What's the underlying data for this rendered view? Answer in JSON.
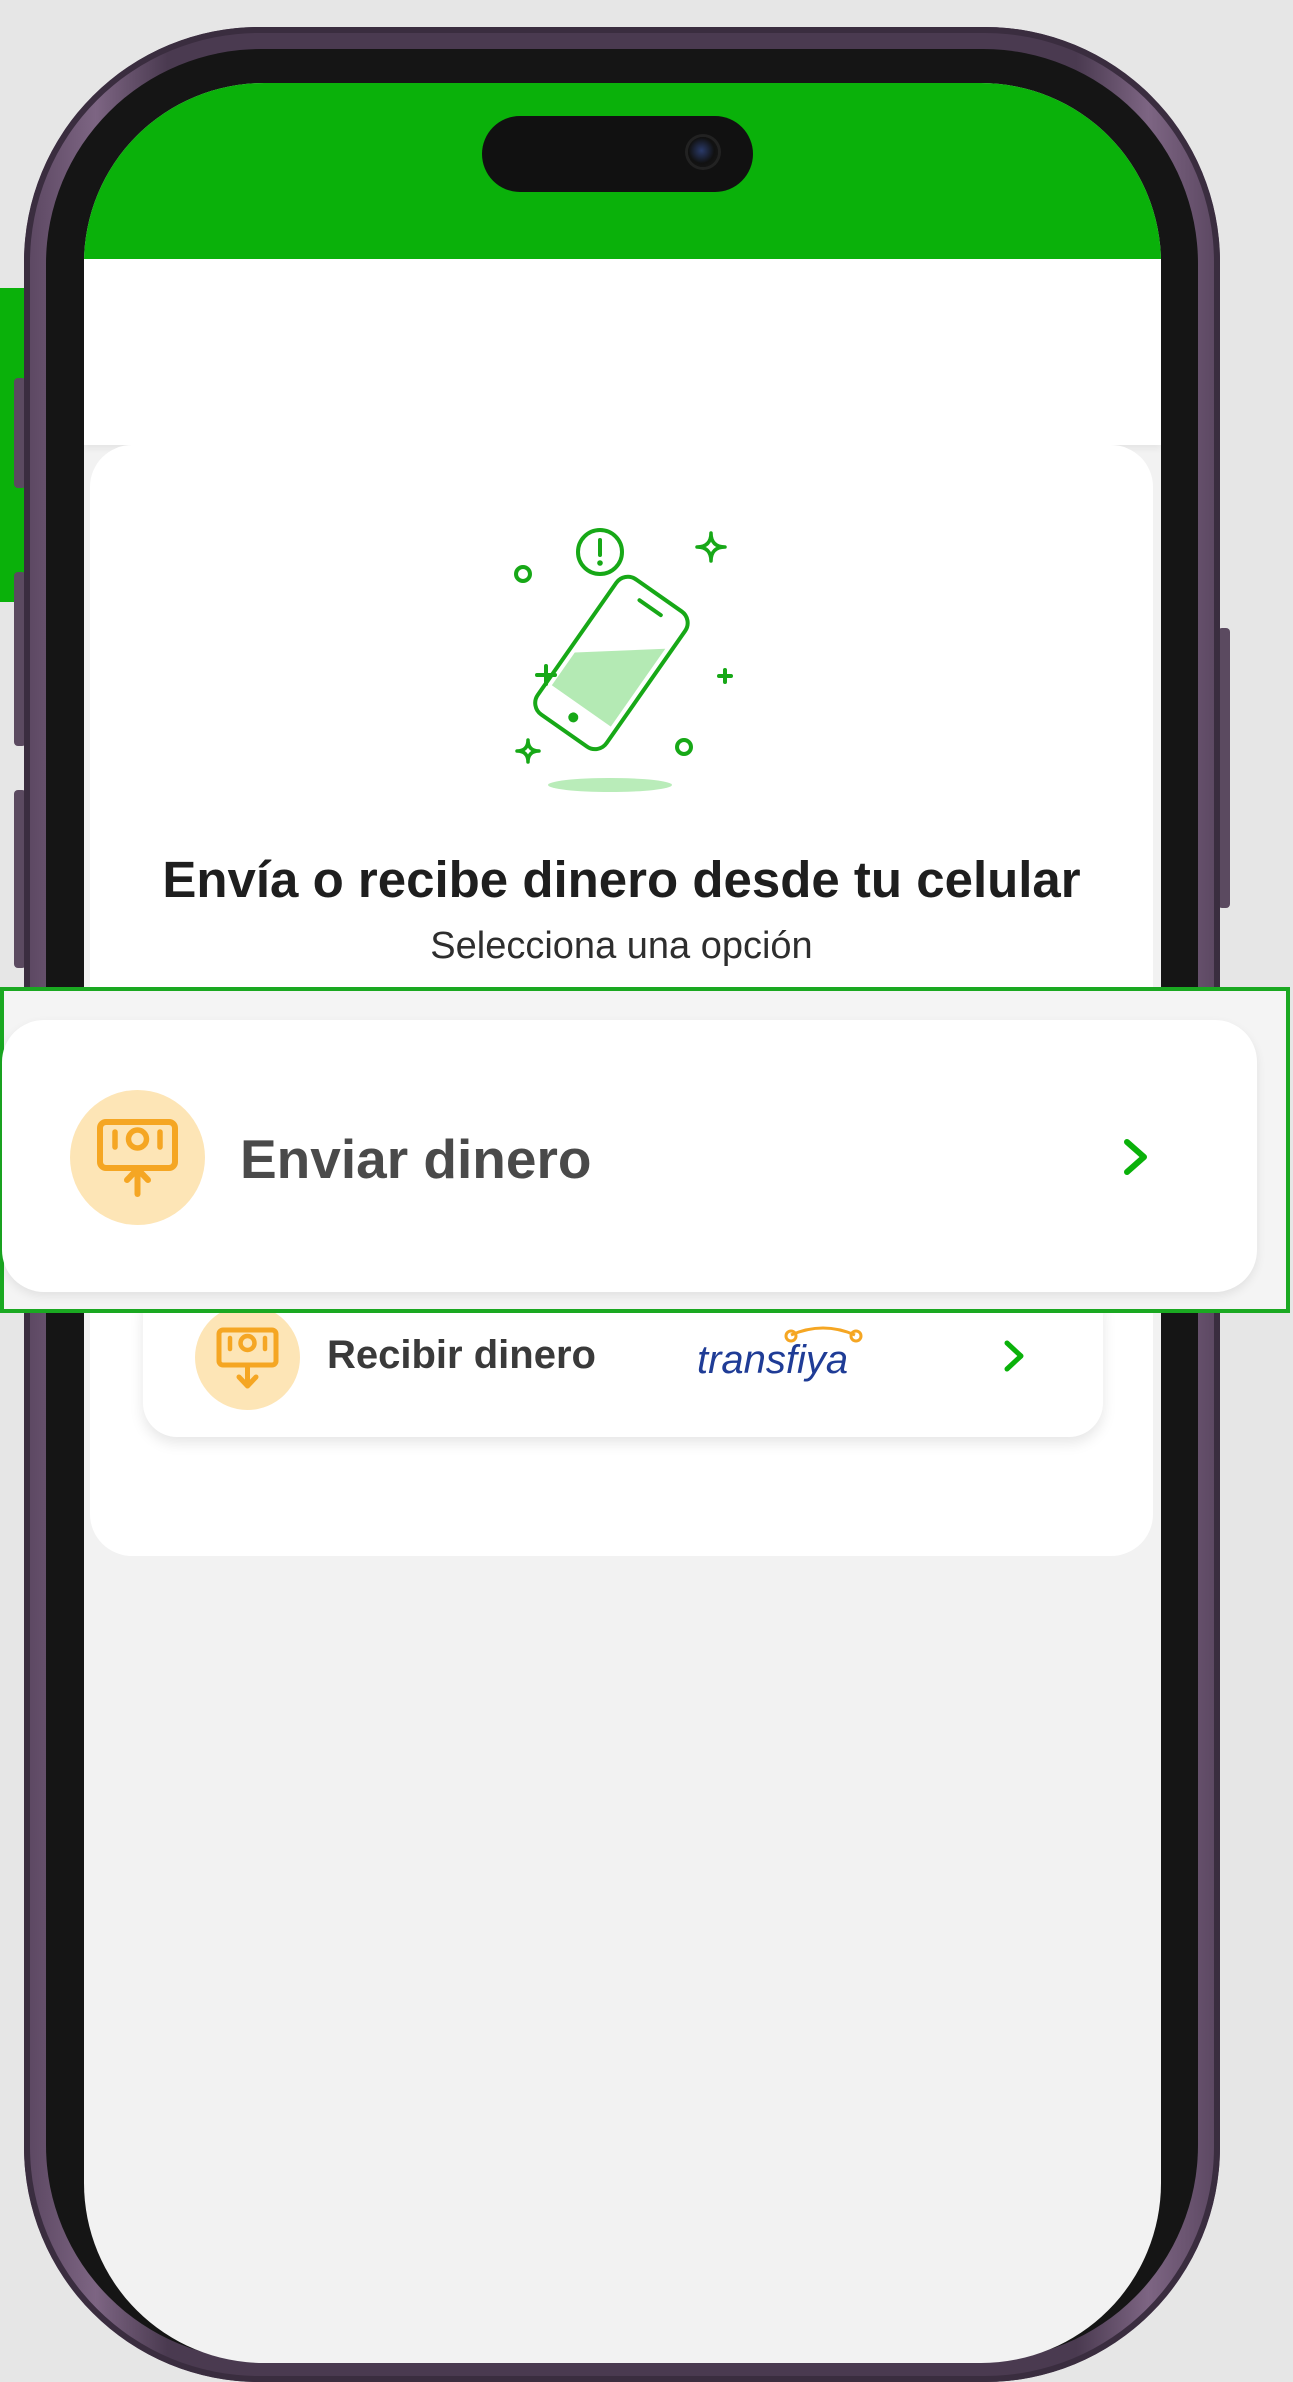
{
  "card": {
    "title": "Envía o recibe dinero desde tu celular",
    "subtitle": "Selecciona una opción"
  },
  "options": {
    "send": {
      "label": "Enviar dinero",
      "icon": "money-send-icon"
    },
    "receive": {
      "label": "Recibir dinero",
      "icon": "money-receive-icon",
      "partner": "transfiya"
    }
  },
  "colors": {
    "brand_green": "#0ab10a",
    "icon_orange": "#f5a623",
    "icon_bg": "#fde5b6",
    "transfiya_blue": "#1f3c96"
  }
}
